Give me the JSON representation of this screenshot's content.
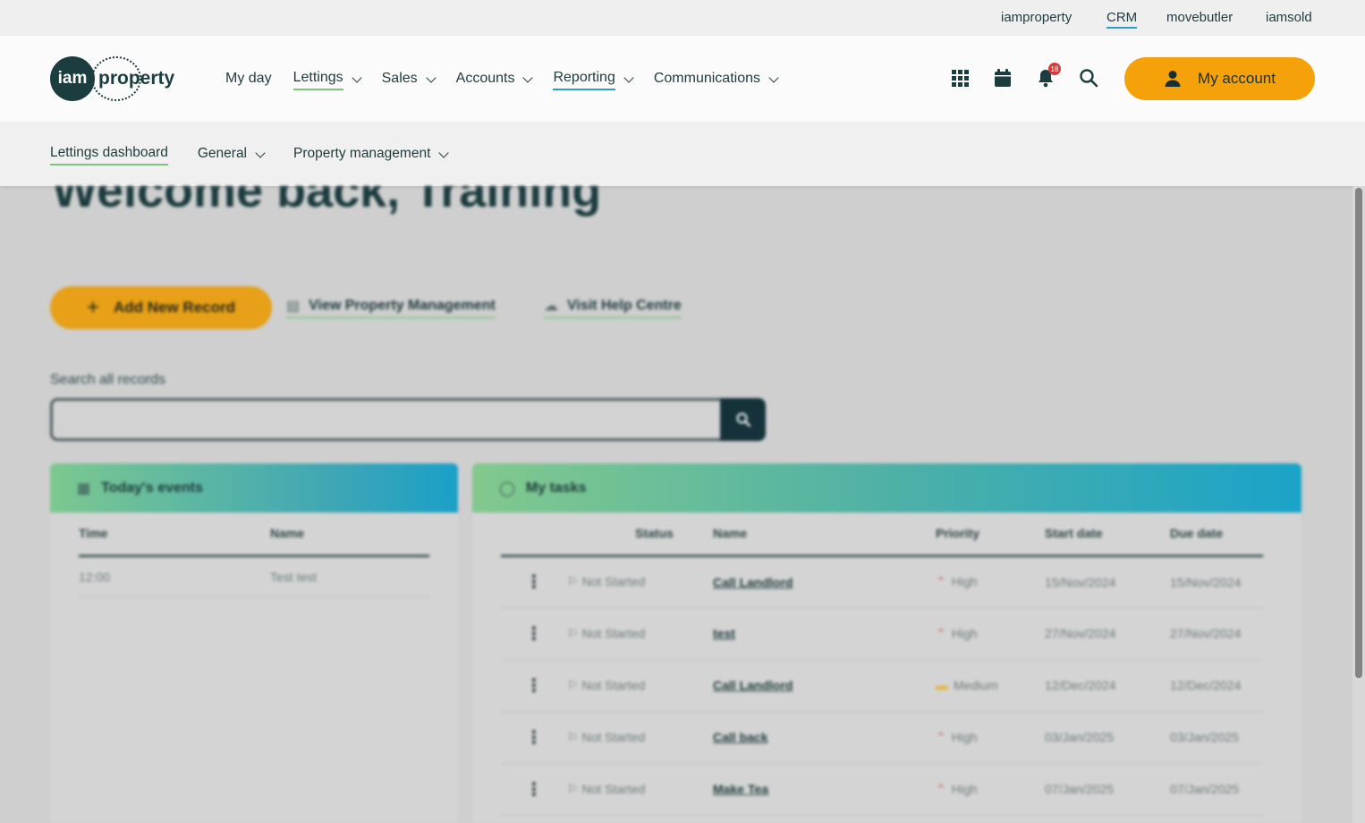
{
  "utility_links": [
    {
      "label": "iamproperty",
      "active": false
    },
    {
      "label": "CRM",
      "active": true
    },
    {
      "label": "movebutler",
      "active": false
    },
    {
      "label": "iamsold",
      "active": false
    }
  ],
  "logo": {
    "circle_text": "iam",
    "text": "property"
  },
  "main_nav": [
    {
      "label": "My day",
      "dropdown": false,
      "state": "none"
    },
    {
      "label": "Lettings",
      "dropdown": true,
      "state": "green"
    },
    {
      "label": "Sales",
      "dropdown": true,
      "state": "none"
    },
    {
      "label": "Accounts",
      "dropdown": true,
      "state": "none"
    },
    {
      "label": "Reporting",
      "dropdown": true,
      "state": "blue"
    },
    {
      "label": "Communications",
      "dropdown": true,
      "state": "none"
    }
  ],
  "header_icons": {
    "apps": "apps-grid-icon",
    "calendar": "calendar-icon",
    "notifications": "bell-icon",
    "notification_count": "18",
    "search": "search-icon"
  },
  "account": {
    "label": "My account",
    "icon": "user-icon"
  },
  "sub_nav": [
    {
      "label": "Lettings dashboard",
      "dropdown": false,
      "active": true
    },
    {
      "label": "General",
      "dropdown": true,
      "active": false
    },
    {
      "label": "Property management",
      "dropdown": true,
      "active": false
    }
  ],
  "welcome": "Welcome back, Training",
  "actions": {
    "add_record": "Add New Record",
    "view_pm": "View Property Management",
    "help": "Visit Help Centre"
  },
  "search": {
    "label": "Search all records",
    "placeholder": "",
    "value": ""
  },
  "events": {
    "title": "Today's events",
    "columns": [
      "Time",
      "Name"
    ],
    "rows": [
      {
        "time": "12:00",
        "name": "Test test"
      }
    ]
  },
  "tasks": {
    "title": "My tasks",
    "columns": [
      "Status",
      "Name",
      "Priority",
      "Start date",
      "Due date"
    ],
    "rows": [
      {
        "status": "Not Started",
        "name": "Call Landlord",
        "priority": "High",
        "start": "15/Nov/2024",
        "due": "15/Nov/2024"
      },
      {
        "status": "Not Started",
        "name": "test",
        "priority": "High",
        "start": "27/Nov/2024",
        "due": "27/Nov/2024"
      },
      {
        "status": "Not Started",
        "name": "Call Landlord",
        "priority": "Medium",
        "start": "12/Dec/2024",
        "due": "12/Dec/2024"
      },
      {
        "status": "Not Started",
        "name": "Call back",
        "priority": "High",
        "start": "03/Jan/2025",
        "due": "03/Jan/2025"
      },
      {
        "status": "Not Started",
        "name": "Make Tea",
        "priority": "High",
        "start": "07/Jan/2025",
        "due": "07/Jan/2025"
      }
    ]
  },
  "colors": {
    "accent": "#f5a20a",
    "brand": "#1c3d40",
    "link_green": "#7ec47c",
    "link_blue": "#29a0c4",
    "badge": "#d63b3b"
  }
}
